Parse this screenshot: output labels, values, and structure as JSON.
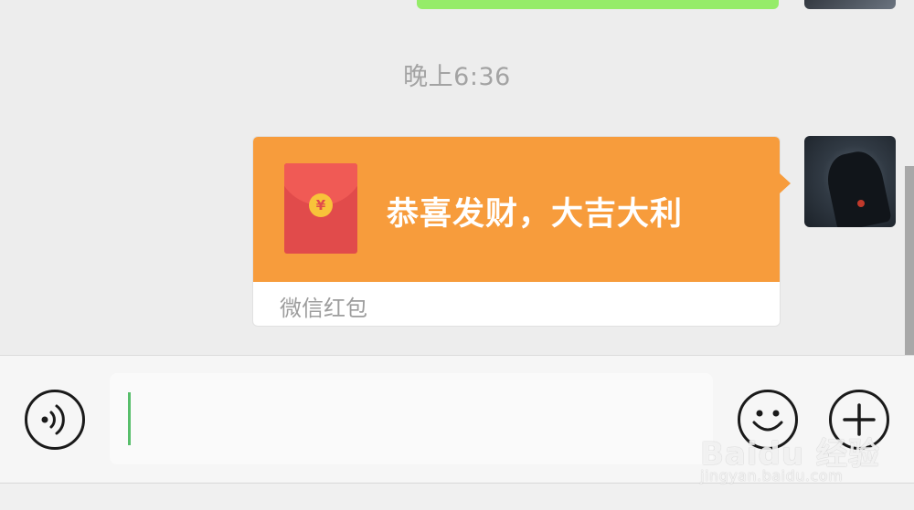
{
  "chat": {
    "timestamp": "晚上6:36",
    "red_packet": {
      "title": "恭喜发财，大吉大利",
      "footer": "微信红包",
      "currency_symbol": "¥",
      "color_orange": "#f79c3c",
      "color_red": "#e14b4b"
    }
  },
  "input_bar": {
    "text_value": "",
    "voice_icon": "voice-icon",
    "emoji_icon": "emoji-icon",
    "plus_icon": "plus-icon"
  },
  "watermark": {
    "brand": "Baidu 经验",
    "url": "jingyan.baidu.com"
  }
}
